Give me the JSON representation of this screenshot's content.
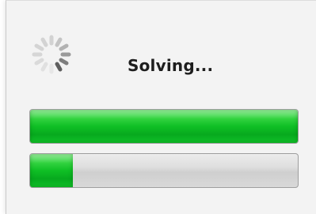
{
  "dialog": {
    "status_text": "Solving...",
    "spinner_icon": "loading-spinner-icon"
  },
  "progress": {
    "overall": {
      "value": 1.0
    },
    "current": {
      "value": 0.16
    }
  },
  "colors": {
    "accent_green": "#14c02a",
    "track_gray": "#d6d6d6"
  }
}
